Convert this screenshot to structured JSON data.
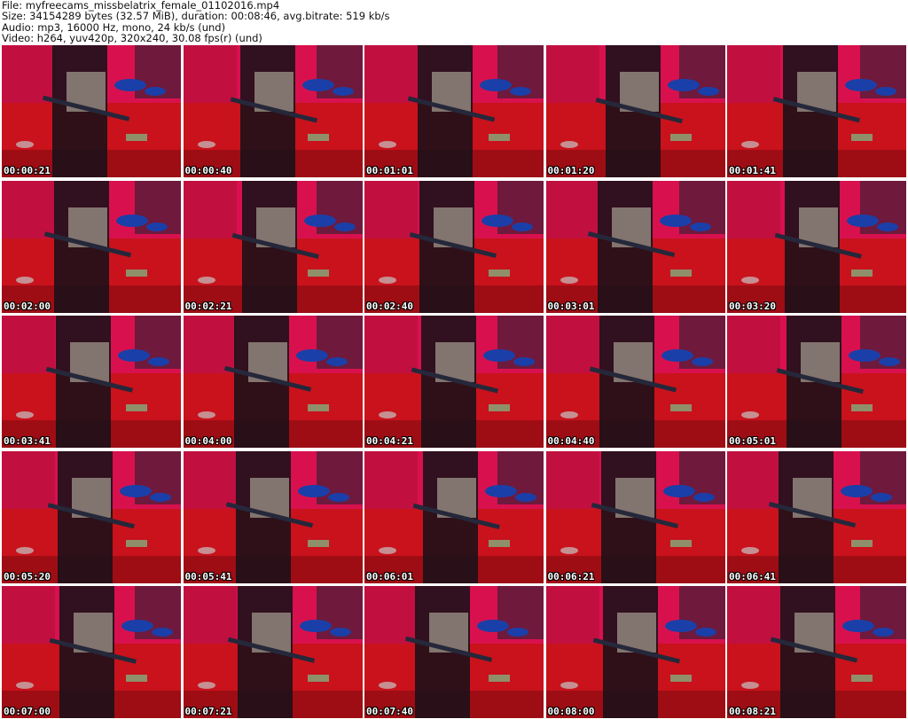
{
  "info": {
    "file": "File: myfreecams_missbelatrix_female_01102016.mp4",
    "size": "Size: 34154289 bytes (32.57 MiB), duration: 00:08:46, avg.bitrate: 519 kb/s",
    "audio": "Audio: mp3, 16000 Hz, mono, 24 kb/s (und)",
    "video": "Video: h264, yuv420p, 320x240, 30.08 fps(r) (und)"
  },
  "thumbnails": [
    "00:00:21",
    "00:00:40",
    "00:01:01",
    "00:01:20",
    "00:01:41",
    "00:02:00",
    "00:02:21",
    "00:02:40",
    "00:03:01",
    "00:03:20",
    "00:03:41",
    "00:04:00",
    "00:04:21",
    "00:04:40",
    "00:05:01",
    "00:05:20",
    "00:05:41",
    "00:06:01",
    "00:06:21",
    "00:06:41",
    "00:07:00",
    "00:07:21",
    "00:07:40",
    "00:08:00",
    "00:08:21"
  ]
}
